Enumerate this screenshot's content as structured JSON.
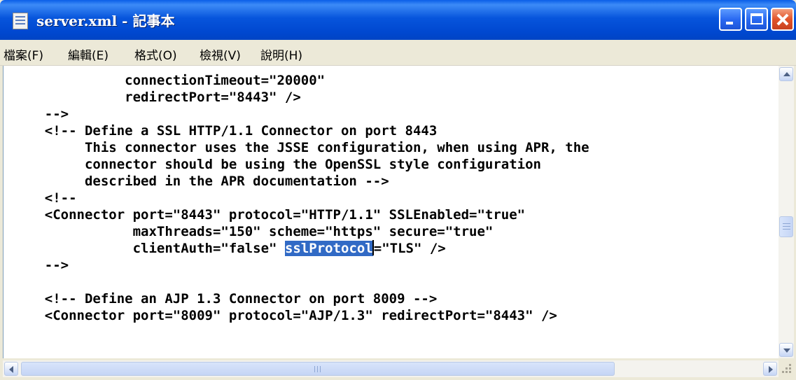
{
  "window": {
    "title": "server.xml - 記事本",
    "icon": "notepad-icon",
    "controls": [
      "minimize-icon",
      "maximize-icon",
      "close-icon"
    ]
  },
  "menu": {
    "file": "檔案(F)",
    "edit": "編輯(E)",
    "format": "格式(O)",
    "view": "檢視(V)",
    "help": "說明(H)"
  },
  "editor": {
    "before_selection": "              connectionTimeout=\"20000\"\n              redirectPort=\"8443\" />\n    -->\n    <!-- Define a SSL HTTP/1.1 Connector on port 8443\n         This connector uses the JSSE configuration, when using APR, the\n         connector should be using the OpenSSL style configuration\n         described in the APR documentation -->\n    <!--\n    <Connector port=\"8443\" protocol=\"HTTP/1.1\" SSLEnabled=\"true\"\n               maxThreads=\"150\" scheme=\"https\" secure=\"true\"\n               clientAuth=\"false\" ",
    "selected_text": "sslProtocol",
    "after_selection": "=\"TLS\" />\n    -->\n\n    <!-- Define an AJP 1.3 Connector on port 8009 -->\n    <Connector port=\"8009\" protocol=\"AJP/1.3\" redirectPort=\"8443\" />",
    "selection_color": "#316ac5"
  },
  "colors": {
    "titlebar": "#0054e3",
    "close_button": "#e2542a",
    "chrome": "#ece9d8"
  }
}
